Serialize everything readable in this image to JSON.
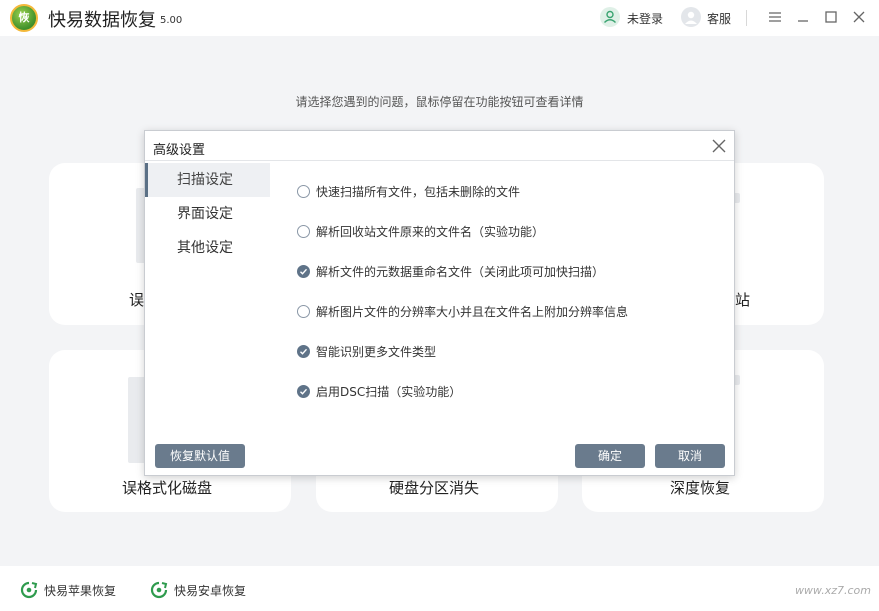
{
  "app": {
    "title": "快易数据恢复",
    "version": "5.00",
    "logo_text": "恢"
  },
  "header": {
    "login_label": "未登录",
    "service_label": "客服"
  },
  "main": {
    "hint": "请选择您遇到的问题，鼠标停留在功能按钮可查看详情",
    "cards": [
      {
        "label": "误"
      },
      {
        "label": "站"
      },
      {
        "label": "误格式化磁盘"
      },
      {
        "label": "硬盘分区消失"
      },
      {
        "label": "深度恢复"
      }
    ]
  },
  "bottom": {
    "apple_label": "快易苹果恢复",
    "android_label": "快易安卓恢复",
    "watermark": "www.xz7.com"
  },
  "dialog": {
    "title": "高级设置",
    "tabs": [
      "扫描设定",
      "界面设定",
      "其他设定"
    ],
    "active_tab": 0,
    "options": [
      {
        "label": "快速扫描所有文件，包括未删除的文件",
        "checked": false
      },
      {
        "label": "解析回收站文件原来的文件名（实验功能）",
        "checked": false
      },
      {
        "label": "解析文件的元数据重命名文件（关闭此项可加快扫描）",
        "checked": true
      },
      {
        "label": "解析图片文件的分辨率大小并且在文件名上附加分辨率信息",
        "checked": false
      },
      {
        "label": "智能识别更多文件类型",
        "checked": true
      },
      {
        "label": "启用DSC扫描（实验功能）",
        "checked": true
      }
    ],
    "reset_label": "恢复默认值",
    "ok_label": "确定",
    "cancel_label": "取消"
  },
  "colors": {
    "accent": "#5f7388",
    "button": "#6a7b8d",
    "logo_green": "#3f8f2a"
  },
  "icons": [
    "user-icon",
    "headset-icon",
    "menu-icon",
    "minimize-icon",
    "maximize-icon",
    "close-icon",
    "check-icon",
    "recover-icon"
  ]
}
